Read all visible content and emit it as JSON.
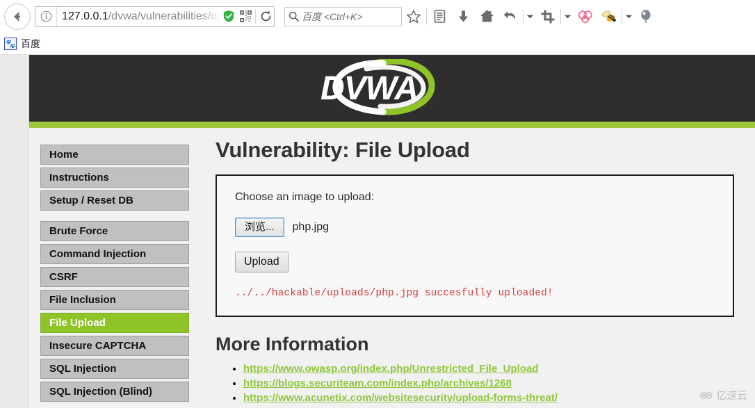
{
  "browser": {
    "back_button": "Back",
    "identity_icon": "info-icon",
    "url": {
      "host": "127.0.0.1",
      "path": "/dvwa/vulnerabilities/uplo"
    },
    "url_icons": [
      "shield-icon",
      "qrcode-icon",
      "reload-icon"
    ],
    "search": {
      "icon": "search-icon",
      "placeholder": "百度 <Ctrl+K>"
    },
    "toolbar_icons": [
      "star-icon",
      "reading-list-icon",
      "download-icon",
      "home-icon",
      "undo-arrow-icon",
      "chevron-down-icon",
      "crop-icon",
      "chevron-down-icon",
      "chain-links-icon",
      "bee-icon",
      "chevron-down-icon",
      "balloon-icon"
    ],
    "bookmarks": [
      {
        "favicon": "baidu-paw-icon",
        "label": "百度"
      }
    ]
  },
  "site": {
    "logo_text": "DVWA",
    "header_bg": "#2e2e2e",
    "accent_green": "#9cc63b"
  },
  "sidebar": {
    "groups": [
      {
        "items": [
          {
            "label": "Home",
            "active": false
          },
          {
            "label": "Instructions",
            "active": false
          },
          {
            "label": "Setup / Reset DB",
            "active": false
          }
        ]
      },
      {
        "items": [
          {
            "label": "Brute Force",
            "active": false
          },
          {
            "label": "Command Injection",
            "active": false
          },
          {
            "label": "CSRF",
            "active": false
          },
          {
            "label": "File Inclusion",
            "active": false
          },
          {
            "label": "File Upload",
            "active": true
          },
          {
            "label": "Insecure CAPTCHA",
            "active": false
          },
          {
            "label": "SQL Injection",
            "active": false
          },
          {
            "label": "SQL Injection (Blind)",
            "active": false
          }
        ]
      }
    ]
  },
  "content": {
    "page_title": "Vulnerability: File Upload",
    "upload_form": {
      "label": "Choose an image to upload:",
      "browse_button": "浏览...",
      "file_name": "php.jpg",
      "submit_button": "Upload",
      "result_message": "../../hackable/uploads/php.jpg succesfully uploaded!",
      "result_color": "#d43c3c"
    },
    "more_information": {
      "title": "More Information",
      "links": [
        "https://www.owasp.org/index.php/Unrestricted_File_Upload",
        "https://blogs.securiteam.com/index.php/archives/1268",
        "https://www.acunetix.com/websitesecurity/upload-forms-threat/"
      ]
    }
  },
  "watermark": {
    "icon": "cloud-icon",
    "text": "亿速云"
  }
}
